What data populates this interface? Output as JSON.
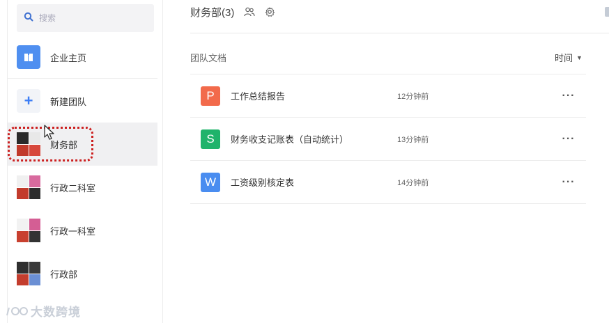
{
  "sidebar": {
    "search_placeholder": "搜索",
    "home_label": "企业主页",
    "new_team_label": "新建团队",
    "teams": [
      {
        "label": "财务部",
        "active": true
      },
      {
        "label": "行政二科室",
        "active": false
      },
      {
        "label": "行政一科室",
        "active": false
      },
      {
        "label": "行政部",
        "active": false
      }
    ]
  },
  "main": {
    "team_title": "财务部(3)",
    "section_label": "团队文档",
    "sort_label": "时间",
    "docs": [
      {
        "type": "P",
        "color": "#f26a4b",
        "name": "工作总结报告",
        "time": "12分钟前"
      },
      {
        "type": "S",
        "color": "#1fb36b",
        "name": "财务收支记账表（自动统计）",
        "time": "13分钟前"
      },
      {
        "type": "W",
        "color": "#4a8df0",
        "name": "工资级别核定表",
        "time": "14分钟前"
      }
    ],
    "more_label": "···"
  },
  "watermark": "大数跨境",
  "colors": {
    "accent": "#3d7ef5",
    "highlight_dotted": "#cc1f1f"
  }
}
